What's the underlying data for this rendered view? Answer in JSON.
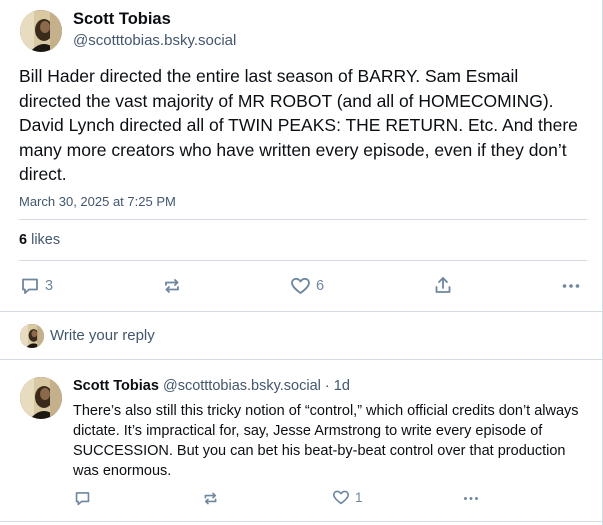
{
  "post": {
    "author_name": "Scott Tobias",
    "author_handle": "@scotttobias.bsky.social",
    "text": "Bill Hader directed the entire last season of BARRY. Sam Esmail directed the vast majority of MR ROBOT (and all of HOMECOMING). David Lynch directed all of TWIN PEAKS: THE RETURN. Etc. And there many more creators who have written every episode, even if they don’t direct.",
    "timestamp": "March 30, 2025 at 7:25 PM",
    "likes_count": "6",
    "likes_label": " likes",
    "actions": {
      "reply_count": "3",
      "like_count": "6"
    }
  },
  "reply_box": {
    "placeholder": "Write your reply"
  },
  "reply": {
    "author_name": "Scott Tobias",
    "author_handle": "@scotttobias.bsky.social",
    "separator": " · ",
    "age": "1d",
    "text": "There’s also still this tricky notion of “control,” which official credits don’t always dictate. It’s impractical for, say, Jesse Armstrong to write every episode of SUCCESSION. But you can bet his beat-by-beat control over that production was enormous.",
    "actions": {
      "like_count": "1"
    }
  },
  "colors": {
    "text_primary": "#0b0f14",
    "text_secondary": "#42576c",
    "icon": "#6f869f",
    "divider": "#d4dbe2"
  },
  "icons": [
    "avatar",
    "reply-icon",
    "repost-icon",
    "like-icon",
    "share-icon",
    "more-icon"
  ]
}
